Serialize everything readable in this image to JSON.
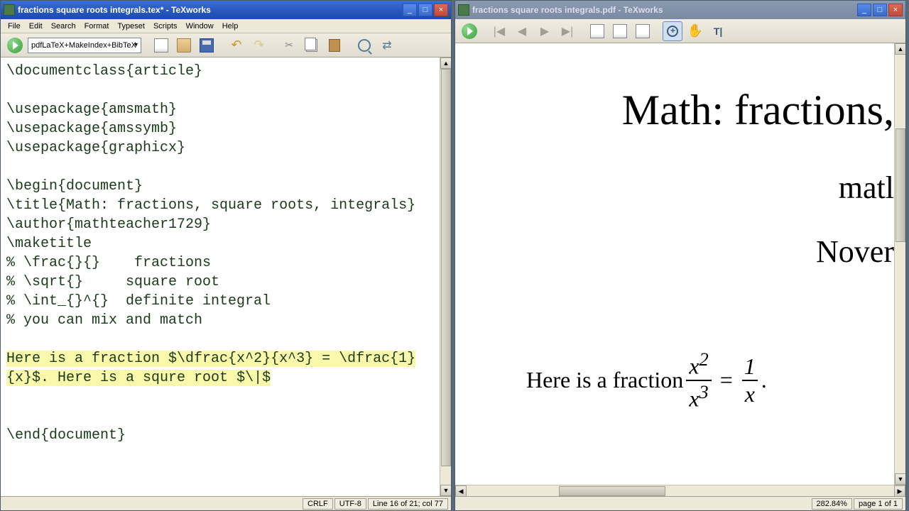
{
  "leftWindow": {
    "title": "fractions square roots integrals.tex* - TeXworks",
    "menu": [
      "File",
      "Edit",
      "Search",
      "Format",
      "Typeset",
      "Scripts",
      "Window",
      "Help"
    ],
    "typesetCombo": "pdfLaTeX+MakeIndex+BibTeX",
    "status": {
      "eol": "CRLF",
      "encoding": "UTF-8",
      "pos": "Line 16 of 21; col 77"
    },
    "source": {
      "l1": "\\documentclass{article}",
      "l2": "",
      "l3": "\\usepackage{amsmath}",
      "l4": "\\usepackage{amssymb}",
      "l5": "\\usepackage{graphicx}",
      "l6": "",
      "l7": "\\begin{document}",
      "l8": "\\title{Math: fractions, square roots, integrals}",
      "l9": "\\author{mathteacher1729}",
      "l10": "\\maketitle",
      "l11": "% \\frac{}{}    fractions",
      "l12": "% \\sqrt{}     square root",
      "l13": "% \\int_{}^{}  definite integral",
      "l14": "% you can mix and match",
      "l15": "",
      "l16a": "Here is a fraction $",
      "l16b": "\\dfrac{x^2}{x^3}",
      "l16c": " = ",
      "l16d": "\\dfrac{1}{x}",
      "l16e": "$. Here is a squre root $\\",
      "l16f": "$",
      "l17": "",
      "l18": "",
      "l19": "\\end{document}"
    }
  },
  "rightWindow": {
    "title": "fractions square roots integrals.pdf - TeXworks",
    "status": {
      "zoom": "282.84%",
      "page": "page 1 of 1"
    },
    "preview": {
      "title": "Math: fractions,",
      "author": "matl",
      "date": "Nover",
      "bodyText": "Here is a fraction",
      "frac1num": "x",
      "frac1numsup": "2",
      "frac1den": "x",
      "frac1densup": "3",
      "frac2num": "1",
      "frac2den": "x",
      "period": "."
    }
  },
  "chart_data": null
}
